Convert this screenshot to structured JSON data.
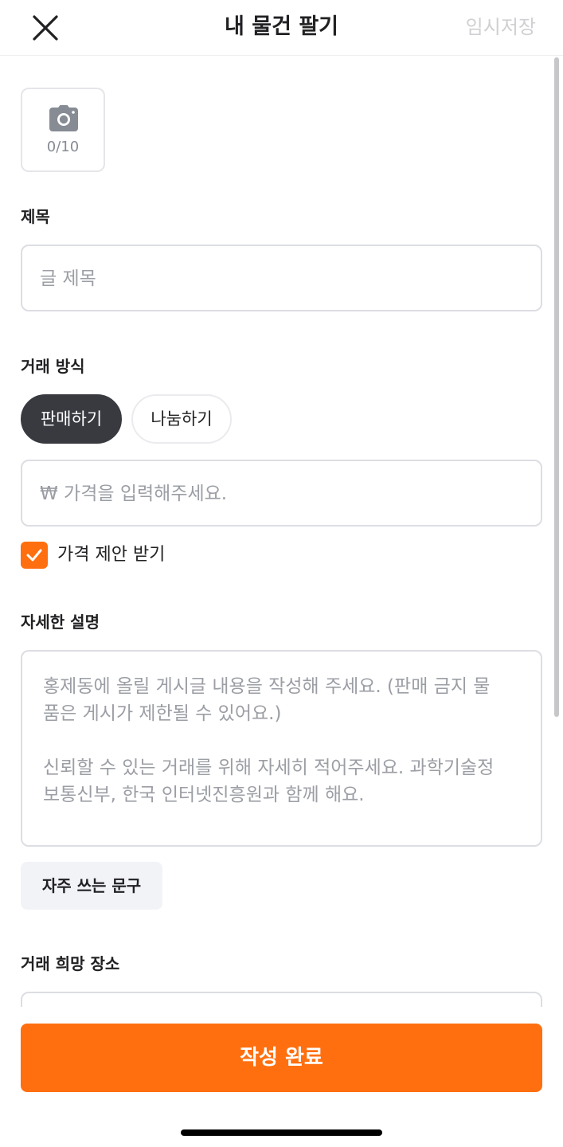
{
  "header": {
    "close_icon": "close-icon",
    "title": "내 물건 팔기",
    "temp_save": "임시저장"
  },
  "photo": {
    "icon": "camera-icon",
    "count": "0/10"
  },
  "title_section": {
    "label": "제목",
    "placeholder": "글 제목"
  },
  "trade_method": {
    "label": "거래 방식",
    "options": [
      {
        "label": "판매하기",
        "selected": true
      },
      {
        "label": "나눔하기",
        "selected": false
      }
    ],
    "price_placeholder": "₩ 가격을 입력해주세요.",
    "offer_checkbox": {
      "label": "가격 제안 받기",
      "checked": true
    }
  },
  "description": {
    "label": "자세한 설명",
    "placeholder_lines": [
      "홍제동에 올릴 게시글 내용을 작성해 주세요. (판매 금지 물",
      "품은 게시가 제한될 수 있어요.)",
      "신뢰할 수 있는 거래를 위해 자세히 적어주세요. 과학기술정",
      "보통신부, 한국 인터넷진흥원과 함께 해요."
    ]
  },
  "frequent_phrases": "자주 쓰는 문구",
  "location": {
    "label": "거래 희망 장소"
  },
  "submit": "작성 완료",
  "colors": {
    "accent": "#ff6f0f",
    "dark_pill": "#393a40",
    "placeholder": "#9b9ea4",
    "border": "#dcdee3"
  }
}
